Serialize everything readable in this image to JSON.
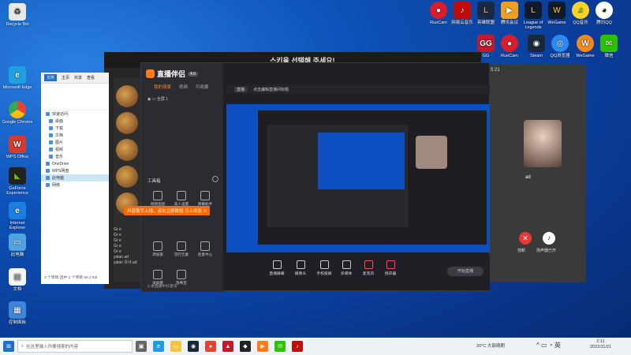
{
  "desktop": {
    "left_icons": [
      {
        "label": "Recycle Bin",
        "color": "#f0f0f0"
      },
      {
        "label": "Microsoft Edge",
        "color": "#1ea0e0"
      },
      {
        "label": "Google Chrome",
        "color": "#e94235"
      },
      {
        "label": "WPS Office",
        "color": "#d83b2a"
      },
      {
        "label": "GeForce Experience",
        "color": "#76b900"
      },
      {
        "label": "Internet Explorer",
        "color": "#1d7de0"
      },
      {
        "label": "此电脑",
        "color": "#4fa3e0"
      },
      {
        "label": "文档",
        "color": "#f5c542"
      },
      {
        "label": "控制面板",
        "color": "#3e86d8"
      }
    ],
    "top_right_icons": [
      {
        "label": "RuoCam",
        "color": "#d81e2a"
      },
      {
        "label": "网易云音乐",
        "color": "#c20c0c"
      },
      {
        "label": "英雄联盟",
        "color": "#1a2a44"
      },
      {
        "label": "腾讯会议",
        "color": "#2d7df6"
      },
      {
        "label": "League of Legends",
        "color": "#c89b3c"
      },
      {
        "label": "WeGame",
        "color": "#f08a1c"
      },
      {
        "label": "QQ音乐",
        "color": "#31c27c"
      },
      {
        "label": "腾讯QQ",
        "color": "#1ea0ff"
      }
    ],
    "top_right_icons2": [
      {
        "label": "GG",
        "color": "#c11a2a"
      },
      {
        "label": "RuoCam",
        "color": "#d81e2a"
      },
      {
        "label": "Steam",
        "color": "#1b2838"
      },
      {
        "label": "QQ浏览器",
        "color": "#2a8cf0"
      },
      {
        "label": "WeGame",
        "color": "#f08a1c"
      },
      {
        "label": "微信",
        "color": "#2dc100"
      }
    ]
  },
  "bg_app": {
    "title": "스키을 선택해 주세요!"
  },
  "explorer": {
    "tabs": [
      "文件",
      "主页",
      "共享",
      "查看"
    ],
    "nav": [
      "快速访问",
      "桌面",
      "下载",
      "文档",
      "图片",
      "视频",
      "音乐",
      "OneDrive",
      "WPS网盘",
      "此电脑",
      "网络"
    ],
    "status": "3 个项目   选中 1 个项目 66.2 KB"
  },
  "zhibo": {
    "app_name": "直播伴侣",
    "version": "4.0",
    "tabs": [
      "我的场景",
      "视频",
      "可收藏"
    ],
    "scene_label": "全屏 1",
    "tool_section": "工具箱",
    "tools": [
      "视频连接",
      "美人设置",
      "弹幕助手",
      "添加第",
      "流行元素",
      "连麦中心",
      "滚屏模",
      "放映室"
    ],
    "preview_title": "点击编辑直播间标题",
    "live_btn": "直播",
    "bottom": [
      "直播屏幕",
      "摄像头",
      "手机投屏",
      "多媒体",
      "麦克风",
      "扬声器"
    ],
    "start_btn": "开始直播",
    "banner_text": "抖音助手上线，点击立即体验",
    "banner_btn": "马上体验",
    "status_bar": "3 本直播中抖音号"
  },
  "chat": {
    "messages": [
      "Gr e",
      "Gr e",
      "Gr e",
      "Gr e",
      "Gr e",
      "yalan ad",
      "yalan 유사 ad"
    ]
  },
  "right_panel": {
    "time": "5:21",
    "caller": "ad",
    "hangup": "挂断",
    "speaker": "扬声器已开"
  },
  "taskbar": {
    "search_placeholder": "在这里输入你要搜索的内容",
    "weather": "20°C 大部晴朗",
    "time": "2:11",
    "date": "2022/11/21"
  }
}
